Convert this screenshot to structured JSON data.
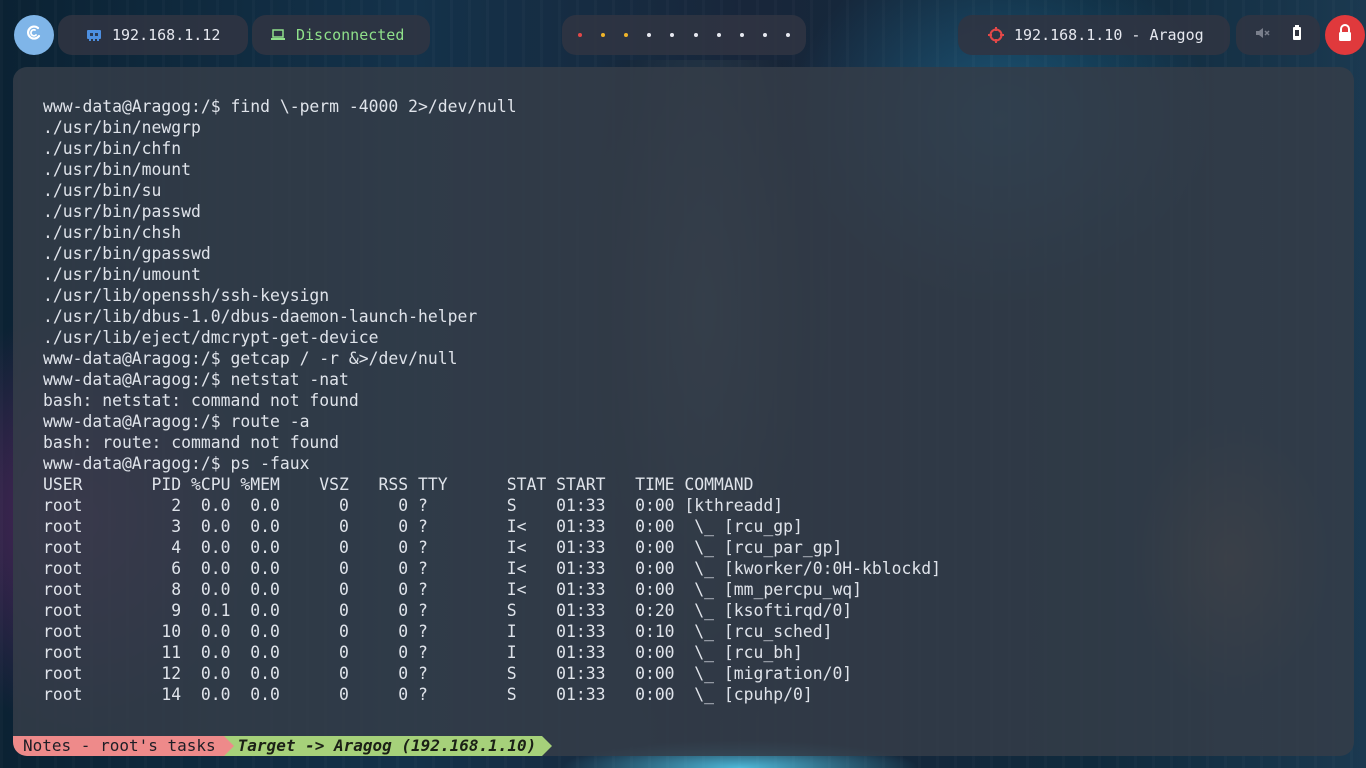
{
  "topbar": {
    "logo_icon": "debian-swirl-icon",
    "host_ip": "192.168.1.12",
    "host_icon": "network-card-icon",
    "vpn_status": "Disconnected",
    "vpn_icon": "laptop-icon",
    "workspace_dot_colors": [
      "#e34848",
      "#f0b429",
      "#f0b429",
      "#e7e9f0",
      "#e7e9f0",
      "#e7e9f0",
      "#e7e9f0",
      "#e7e9f0",
      "#e7e9f0",
      "#e7e9f0"
    ],
    "target_label": "192.168.1.10 - Aragog",
    "target_icon": "crosshair-icon",
    "target_icon_color": "#e34848",
    "volume_icon": "volume-muted-icon",
    "battery_icon": "battery-icon",
    "lock_icon": "lock-icon",
    "lock_color": "#e0393c"
  },
  "terminal": {
    "lines": [
      "www-data@Aragog:/$ find \\-perm -4000 2>/dev/null",
      "./usr/bin/newgrp",
      "./usr/bin/chfn",
      "./usr/bin/mount",
      "./usr/bin/su",
      "./usr/bin/passwd",
      "./usr/bin/chsh",
      "./usr/bin/gpasswd",
      "./usr/bin/umount",
      "./usr/lib/openssh/ssh-keysign",
      "./usr/lib/dbus-1.0/dbus-daemon-launch-helper",
      "./usr/lib/eject/dmcrypt-get-device",
      "www-data@Aragog:/$ getcap / -r &>/dev/null",
      "www-data@Aragog:/$ netstat -nat",
      "bash: netstat: command not found",
      "www-data@Aragog:/$ route -a",
      "bash: route: command not found",
      "www-data@Aragog:/$ ps -faux",
      "USER       PID %CPU %MEM    VSZ   RSS TTY      STAT START   TIME COMMAND",
      "root         2  0.0  0.0      0     0 ?        S    01:33   0:00 [kthreadd]",
      "root         3  0.0  0.0      0     0 ?        I<   01:33   0:00  \\_ [rcu_gp]",
      "root         4  0.0  0.0      0     0 ?        I<   01:33   0:00  \\_ [rcu_par_gp]",
      "root         6  0.0  0.0      0     0 ?        I<   01:33   0:00  \\_ [kworker/0:0H-kblockd]",
      "root         8  0.0  0.0      0     0 ?        I<   01:33   0:00  \\_ [mm_percpu_wq]",
      "root         9  0.1  0.0      0     0 ?        S    01:33   0:20  \\_ [ksoftirqd/0]",
      "root        10  0.0  0.0      0     0 ?        I    01:33   0:10  \\_ [rcu_sched]",
      "root        11  0.0  0.0      0     0 ?        I    01:33   0:00  \\_ [rcu_bh]",
      "root        12  0.0  0.0      0     0 ?        S    01:33   0:00  \\_ [migration/0]",
      "root        14  0.0  0.0      0     0 ?        S    01:33   0:00  \\_ [cpuhp/0]"
    ]
  },
  "statusbar": {
    "notes": "Notes - root's tasks",
    "notes_color": "#ee8a8a",
    "target": "Target -> Aragog (192.168.1.10)",
    "target_color": "#a6d17a"
  }
}
